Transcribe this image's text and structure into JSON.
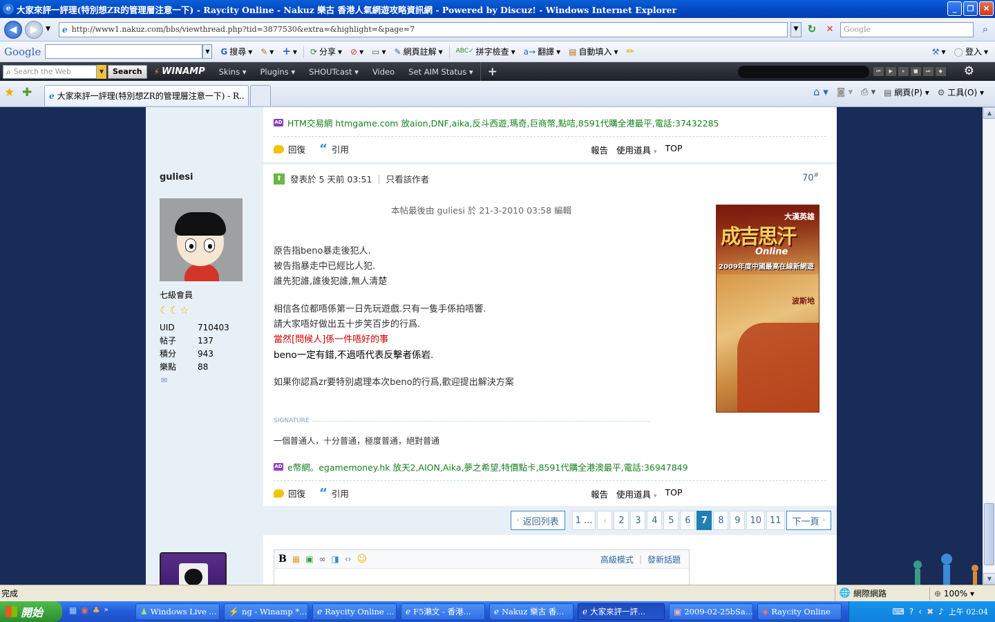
{
  "window": {
    "title": "大家來評一評理(特別想ZR的管理層注意一下) - Raycity Online - Nakuz 樂古 香港人氣網遊攻略資訊網 - Powered by Discuz! - Windows Internet Explorer",
    "btn_min": "_",
    "btn_max": "❐",
    "btn_close": "✕"
  },
  "address": {
    "url": "http://www1.nakuz.com/bbs/viewthread.php?tid=3877530&extra=&highlight=&page=7",
    "search_placeholder": "Google",
    "back": "◀",
    "forward": "▶",
    "page_icon": "e",
    "refresh": "↻",
    "stop": "✕",
    "search_btn": "⌕"
  },
  "googlebar": {
    "logo": "Google",
    "search": "搜尋",
    "share": "分享",
    "notes": "網頁註解",
    "spell": "拼字檢查",
    "translate": "翻譯",
    "autofill": "自動填入",
    "login": "登入"
  },
  "winamp": {
    "search_placeholder": "Search the Web",
    "search_btn": "Search",
    "logo": "WINAMP",
    "menu": [
      "Skins",
      "Plugins",
      "SHOUTcast",
      "Video",
      "Set AIM Status"
    ],
    "add": "+"
  },
  "tabs": {
    "active_label": "大家來評一評理(特別想ZR的管理層注意一下) - R...",
    "page_menu": "網頁(P)",
    "tools_menu": "工具(O)"
  },
  "forum": {
    "ad1": "HTM交易網 htmgame.com 放aion,DNF,aika,反斗西遊,瑪奇,巨商幣,點咭,8591代購全港最平,電話:37432285",
    "ad_badge": "AD",
    "reply": "回復",
    "quote": "引用",
    "report": "報告",
    "tools": "使用道具",
    "top": "TOP",
    "post": {
      "author": "guliesi",
      "rank": "七級會員",
      "stats": [
        {
          "k": "UID",
          "v": "710403"
        },
        {
          "k": "帖子",
          "v": "137"
        },
        {
          "k": "積分",
          "v": "943"
        },
        {
          "k": "樂點",
          "v": "88"
        }
      ],
      "posted_at": "發表於 5 天前 03:51",
      "author_only": "只看該作者",
      "floor": "70",
      "floor_mark": "#",
      "edit_note": "本帖最後由 guliesi 於 21-3-2010 03:58 編輯",
      "lines": [
        "原告指beno暴走後犯人.",
        "被告指暴走中已經比人犯.",
        "誰先犯誰,誰後犯誰,無人清楚",
        "相信各位都唔係第一日先玩遊戲.只有一隻手係拍唔響.",
        "請大家唔好做出五十步笑百步的行爲.",
        "當然[問候人]係一件唔好的事",
        "beno一定有錯,不過唔代表反擊者係岩.",
        "如果你認爲zr要特別處理本次beno的行爲,歡迎提出解決方案"
      ],
      "signature_label": "SIGNATURE",
      "signature": "一個普通人，十分普通，極度普通，絕對普通",
      "ad2": "e幣網。egamemoney.hk 放天2,AION,Aika,夢之希望,特價點卡,8591代購全港澳最平,電話:36947849",
      "banner": {
        "top": "大漢英雄",
        "main": "成吉思汗",
        "sub": "Online",
        "tag": "2009年度中國最高在線新網遊",
        "corner": "波斯地"
      }
    },
    "pager": {
      "back": "返回列表",
      "first": "1 ...",
      "prev": "‹",
      "pages": [
        "2",
        "3",
        "4",
        "5",
        "6",
        "7",
        "8",
        "9",
        "10",
        "11"
      ],
      "current": "7",
      "next": "下一頁"
    },
    "editor": {
      "bold": "B",
      "advanced": "高級模式",
      "new_topic": "發新話題"
    }
  },
  "status": {
    "left": "完成",
    "zone": "網際網路",
    "zoom": "100%"
  },
  "taskbar": {
    "start": "開始",
    "tasks": [
      "Windows Live ...",
      "ng - Winamp *...",
      "Raycity Online ...",
      "F5瀨文 - 香港...",
      "Nakuz 樂古 香...",
      "大家來評一評...",
      "2009-02-25bSa...",
      "Raycity Online"
    ],
    "clock": "上午 02:04"
  },
  "colors": {
    "page_bg": "#192b57",
    "accent": "#1f7fb6",
    "ad_green": "#15811f",
    "edit_red": "#cc0000"
  }
}
